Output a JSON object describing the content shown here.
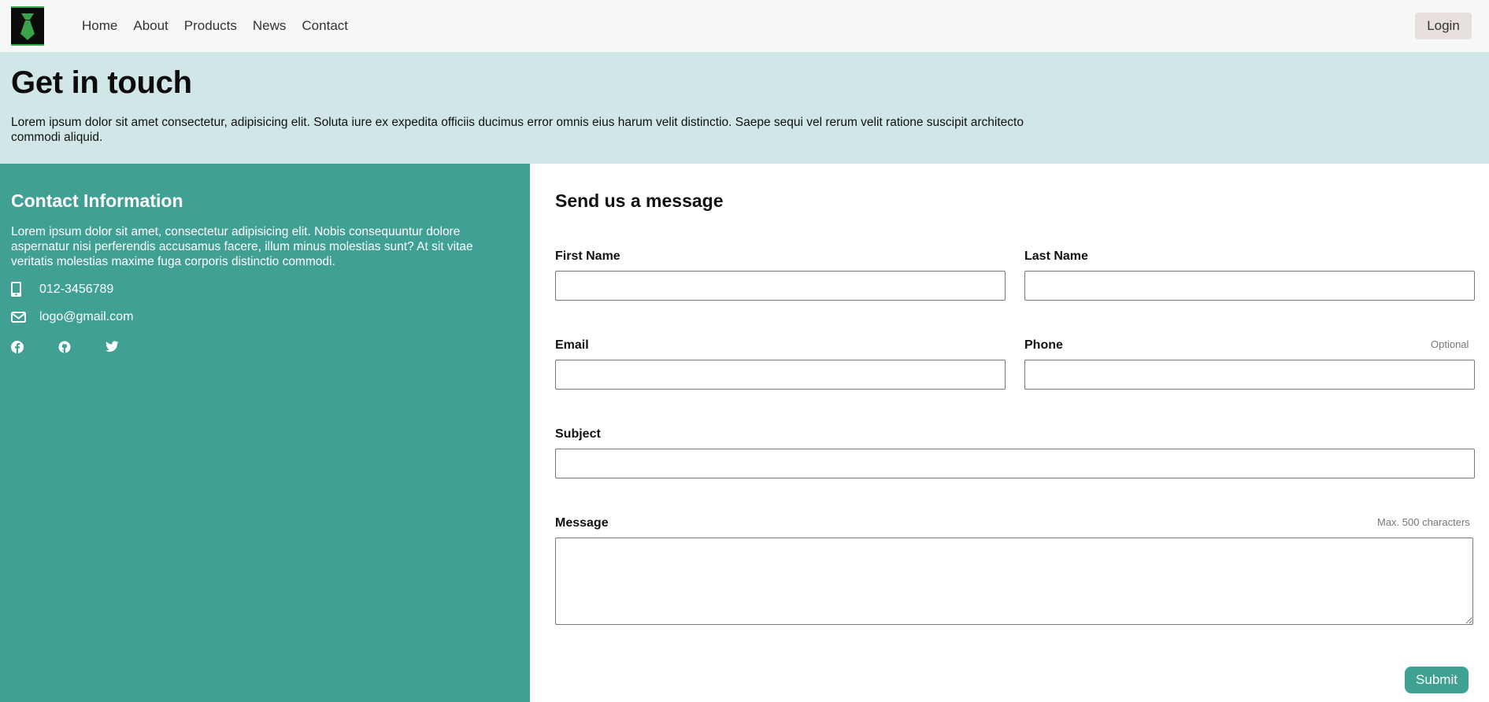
{
  "nav": {
    "items": [
      "Home",
      "About",
      "Products",
      "News",
      "Contact"
    ],
    "login_label": "Login"
  },
  "hero": {
    "title": "Get in touch",
    "text": "Lorem ipsum dolor sit amet consectetur, adipisicing elit. Soluta iure ex expedita officiis ducimus error omnis eius harum velit distinctio. Saepe sequi vel rerum velit ratione suscipit architecto commodi aliquid."
  },
  "contact_info": {
    "title": "Contact Information",
    "text": "Lorem ipsum dolor sit amet, consectetur adipisicing elit. Nobis consequuntur dolore aspernatur nisi perferendis accusamus facere, illum minus molestias sunt? At sit vitae veritatis molestias maxime fuga corporis distinctio commodi.",
    "phone": "012-3456789",
    "email": "logo@gmail.com",
    "icons": [
      "mobile-phone-icon",
      "envelope-icon",
      "facebook-icon",
      "github-icon",
      "twitter-icon"
    ]
  },
  "form": {
    "title": "Send us a message",
    "first_name_label": "First Name",
    "last_name_label": "Last Name",
    "email_label": "Email",
    "phone_label": "Phone",
    "phone_hint": "Optional",
    "subject_label": "Subject",
    "message_label": "Message",
    "message_hint": "Max. 500 characters",
    "submit_label": "Submit"
  },
  "colors": {
    "header_bg": "#f7f7f7",
    "hero_bg": "#d1e6e6",
    "panel_bg": "#40a093",
    "submit_bg": "#3fa192",
    "logo_accent": "#3aa34a"
  }
}
